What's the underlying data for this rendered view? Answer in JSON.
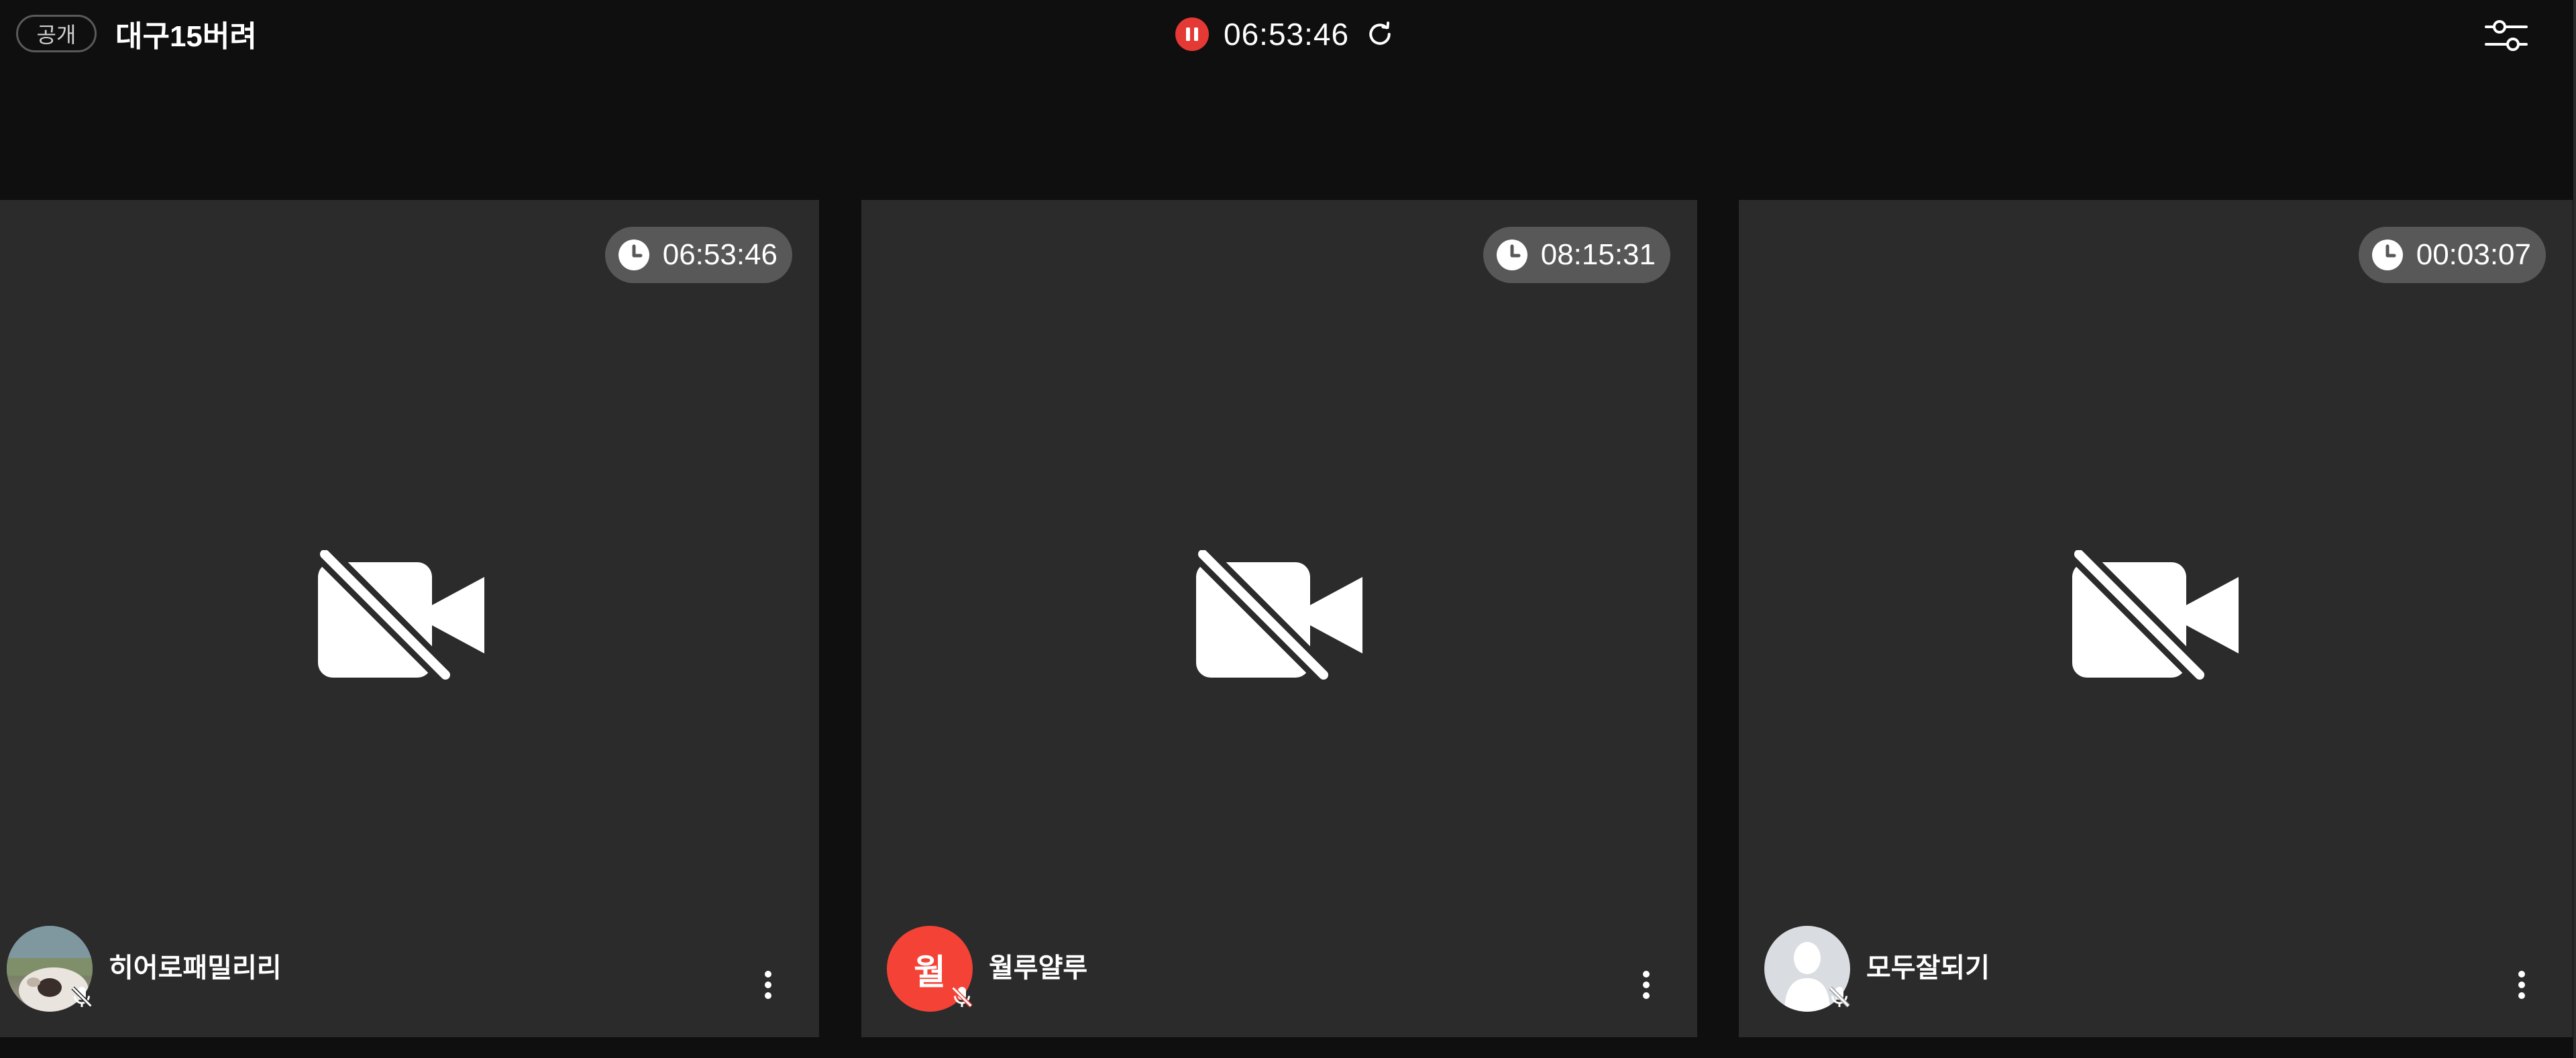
{
  "header": {
    "visibility_label": "공개",
    "room_title": "대구15버려",
    "recording_time": "06:53:46"
  },
  "icons": {
    "pause": "pause-icon",
    "refresh": "refresh-icon",
    "settings": "sliders-icon",
    "clock": "clock-icon",
    "camera_off": "video-off-icon",
    "mic_off": "mic-off-icon",
    "more": "more-vertical-icon"
  },
  "colors": {
    "background": "#0f0f0f",
    "tile": "#2b2b2b",
    "badge": "#585858",
    "recording": "#e53935",
    "initial_avatar": "#f44336"
  },
  "participants": [
    {
      "name": "히어로패밀리리",
      "elapsed": "06:53:46",
      "avatar_type": "photo"
    },
    {
      "name": "월루얄루",
      "elapsed": "08:15:31",
      "avatar_type": "initial",
      "avatar_initial": "월"
    },
    {
      "name": "모두잘되기",
      "elapsed": "00:03:07",
      "avatar_type": "default"
    }
  ]
}
